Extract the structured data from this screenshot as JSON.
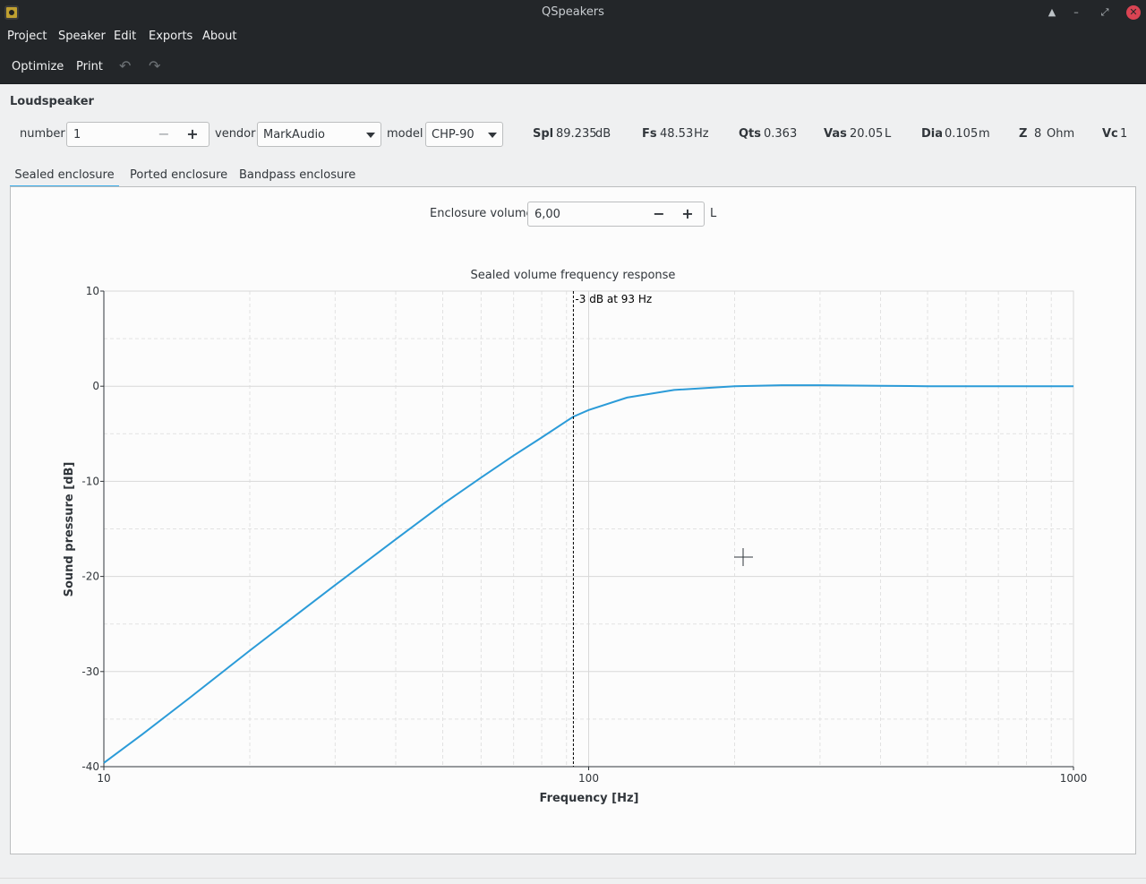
{
  "window": {
    "title": "QSpeakers"
  },
  "menu": {
    "items": [
      "Project",
      "Speaker",
      "Edit",
      "Exports",
      "About"
    ]
  },
  "toolbar": {
    "optimize": "Optimize",
    "print": "Print"
  },
  "loudspeaker": {
    "section_title": "Loudspeaker",
    "number_label": "number",
    "number_value": "1",
    "vendor_label": "vendor",
    "vendor_value": "MarkAudio",
    "model_label": "model",
    "model_value": "CHP-90",
    "params": {
      "spl": {
        "label": "Spl",
        "value": "89.235",
        "unit": "dB"
      },
      "fs": {
        "label": "Fs",
        "value": "48.53",
        "unit": "Hz"
      },
      "qts": {
        "label": "Qts",
        "value": "0.363"
      },
      "vas": {
        "label": "Vas",
        "value": "20.05",
        "unit": "L"
      },
      "dia": {
        "label": "Dia",
        "value": "0.105",
        "unit": "m"
      },
      "z": {
        "label": "Z",
        "value": "8",
        "unit": "Ohm"
      },
      "vc": {
        "label": "Vc",
        "value": "1"
      }
    }
  },
  "tabs": [
    "Sealed enclosure",
    "Ported enclosure",
    "Bandpass enclosure"
  ],
  "enclosure": {
    "label": "Enclosure volume",
    "value": "6,00",
    "unit": "L"
  },
  "chart_data": {
    "type": "line",
    "title": "Sealed volume frequency response",
    "xlabel": "Frequency [Hz]",
    "ylabel": "Sound pressure [dB]",
    "x_scale": "log",
    "xlim": [
      10,
      1000
    ],
    "ylim": [
      -40,
      10
    ],
    "x_ticks": [
      "10",
      "100",
      "1000"
    ],
    "y_ticks": [
      "10",
      "0",
      "-10",
      "-20",
      "-30",
      "-40"
    ],
    "grid": true,
    "line_color": "#2b9bd8",
    "annotation": {
      "text": "-3 dB at 93 Hz",
      "x": 93
    },
    "series": [
      {
        "x": [
          10,
          12,
          15,
          20,
          25,
          30,
          40,
          50,
          60,
          70,
          80,
          93,
          100,
          120,
          150,
          200,
          250,
          300,
          400,
          500,
          700,
          1000
        ],
        "values": [
          -39.6,
          -36.6,
          -32.8,
          -27.8,
          -24.0,
          -20.9,
          -16.1,
          -12.4,
          -9.6,
          -7.3,
          -5.4,
          -3.2,
          -2.5,
          -1.2,
          -0.4,
          0.0,
          0.1,
          0.1,
          0.05,
          0.0,
          0.0,
          0.0
        ]
      }
    ]
  }
}
